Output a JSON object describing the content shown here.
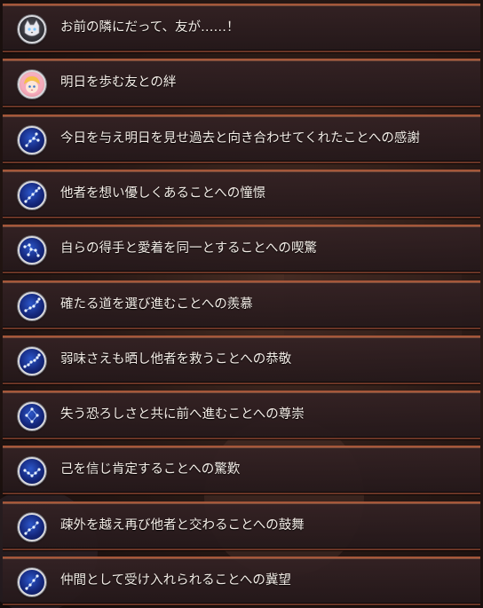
{
  "items": [
    {
      "label": "お前の隣にだって、友が……！",
      "icon": "cat-face-icon",
      "icon_type": "cat"
    },
    {
      "label": "明日を歩む友との絆",
      "icon": "girl-portrait-icon",
      "icon_type": "girl"
    },
    {
      "label": "今日を与え明日を見せ過去と向き合わせてくれたことへの感謝",
      "icon": "constellation-icon",
      "icon_type": "const"
    },
    {
      "label": "他者を想い優しくあることへの憧憬",
      "icon": "constellation-icon",
      "icon_type": "const"
    },
    {
      "label": "自らの得手と愛着を同一とすることへの喫驚",
      "icon": "constellation-icon",
      "icon_type": "const"
    },
    {
      "label": "確たる道を選び進むことへの羨慕",
      "icon": "constellation-icon",
      "icon_type": "const"
    },
    {
      "label": "弱味さえも晒し他者を救うことへの恭敬",
      "icon": "constellation-icon",
      "icon_type": "const"
    },
    {
      "label": "失う恐ろしさと共に前へ進むことへの尊崇",
      "icon": "constellation-icon",
      "icon_type": "const"
    },
    {
      "label": "己を信じ肯定することへの驚歎",
      "icon": "constellation-icon",
      "icon_type": "const"
    },
    {
      "label": "疎外を越え再び他者と交わることへの鼓舞",
      "icon": "constellation-icon",
      "icon_type": "const"
    },
    {
      "label": "仲間として受け入れられることへの冀望",
      "icon": "constellation-icon",
      "icon_type": "const"
    }
  ],
  "colors": {
    "frame": "#a5573a",
    "row_bg": "#2c1e20",
    "text": "#f3ece6",
    "constellation_blue": "#1a32a0"
  }
}
